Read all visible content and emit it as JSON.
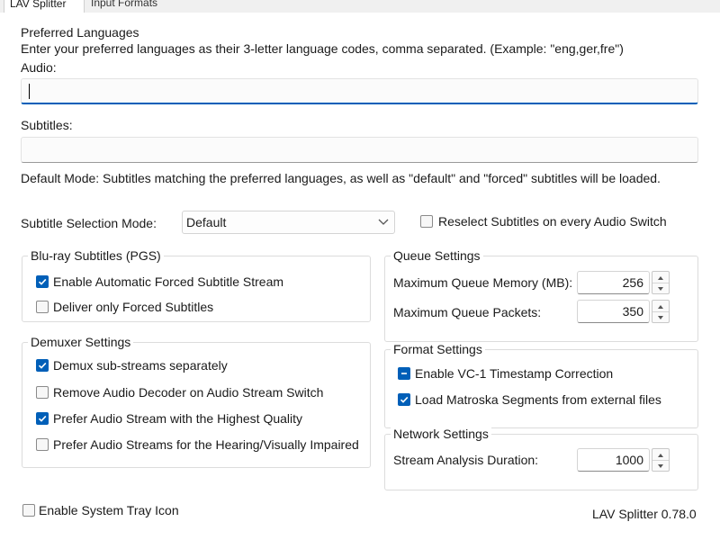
{
  "tabs": [
    {
      "label": "LAV Splitter",
      "active": true
    },
    {
      "label": "Input Formats",
      "active": false
    }
  ],
  "preferred_languages": {
    "title": "Preferred Languages",
    "instruction": "Enter your preferred languages as their 3-letter language codes, comma separated. (Example: \"eng,ger,fre\")",
    "audio_label": "Audio:",
    "audio_value": "",
    "subtitles_label": "Subtitles:",
    "subtitles_value": "",
    "mode_description": "Default Mode: Subtitles matching the preferred languages, as well as \"default\" and \"forced\" subtitles will be loaded."
  },
  "subtitle_selection": {
    "label": "Subtitle Selection Mode:",
    "selected": "Default",
    "reselect_label": "Reselect Subtitles on every Audio Switch",
    "reselect_checked": false
  },
  "bluray": {
    "title": "Blu-ray Subtitles (PGS)",
    "items": [
      {
        "label": "Enable Automatic Forced Subtitle Stream",
        "checked": true
      },
      {
        "label": "Deliver only Forced Subtitles",
        "checked": false
      }
    ]
  },
  "demuxer": {
    "title": "Demuxer Settings",
    "items": [
      {
        "label": "Demux sub-streams separately",
        "checked": true
      },
      {
        "label": "Remove Audio Decoder on Audio Stream Switch",
        "checked": false
      },
      {
        "label": "Prefer Audio Stream with the Highest Quality",
        "checked": true
      },
      {
        "label": "Prefer Audio Streams for the Hearing/Visually Impaired",
        "checked": false
      }
    ]
  },
  "queue": {
    "title": "Queue Settings",
    "memory_label": "Maximum Queue Memory (MB):",
    "memory_value": "256",
    "packets_label": "Maximum Queue Packets:",
    "packets_value": "350"
  },
  "format": {
    "title": "Format Settings",
    "items": [
      {
        "label": "Enable VC-1 Timestamp Correction",
        "state": "indeterminate"
      },
      {
        "label": "Load Matroska Segments from external files",
        "state": "checked"
      }
    ]
  },
  "network": {
    "title": "Network Settings",
    "duration_label": "Stream Analysis Duration:",
    "duration_value": "1000"
  },
  "footer": {
    "tray_label": "Enable System Tray Icon",
    "tray_checked": false,
    "version": "LAV Splitter 0.78.0"
  },
  "colors": {
    "accent": "#005fb8",
    "border": "#dcdcdc"
  }
}
